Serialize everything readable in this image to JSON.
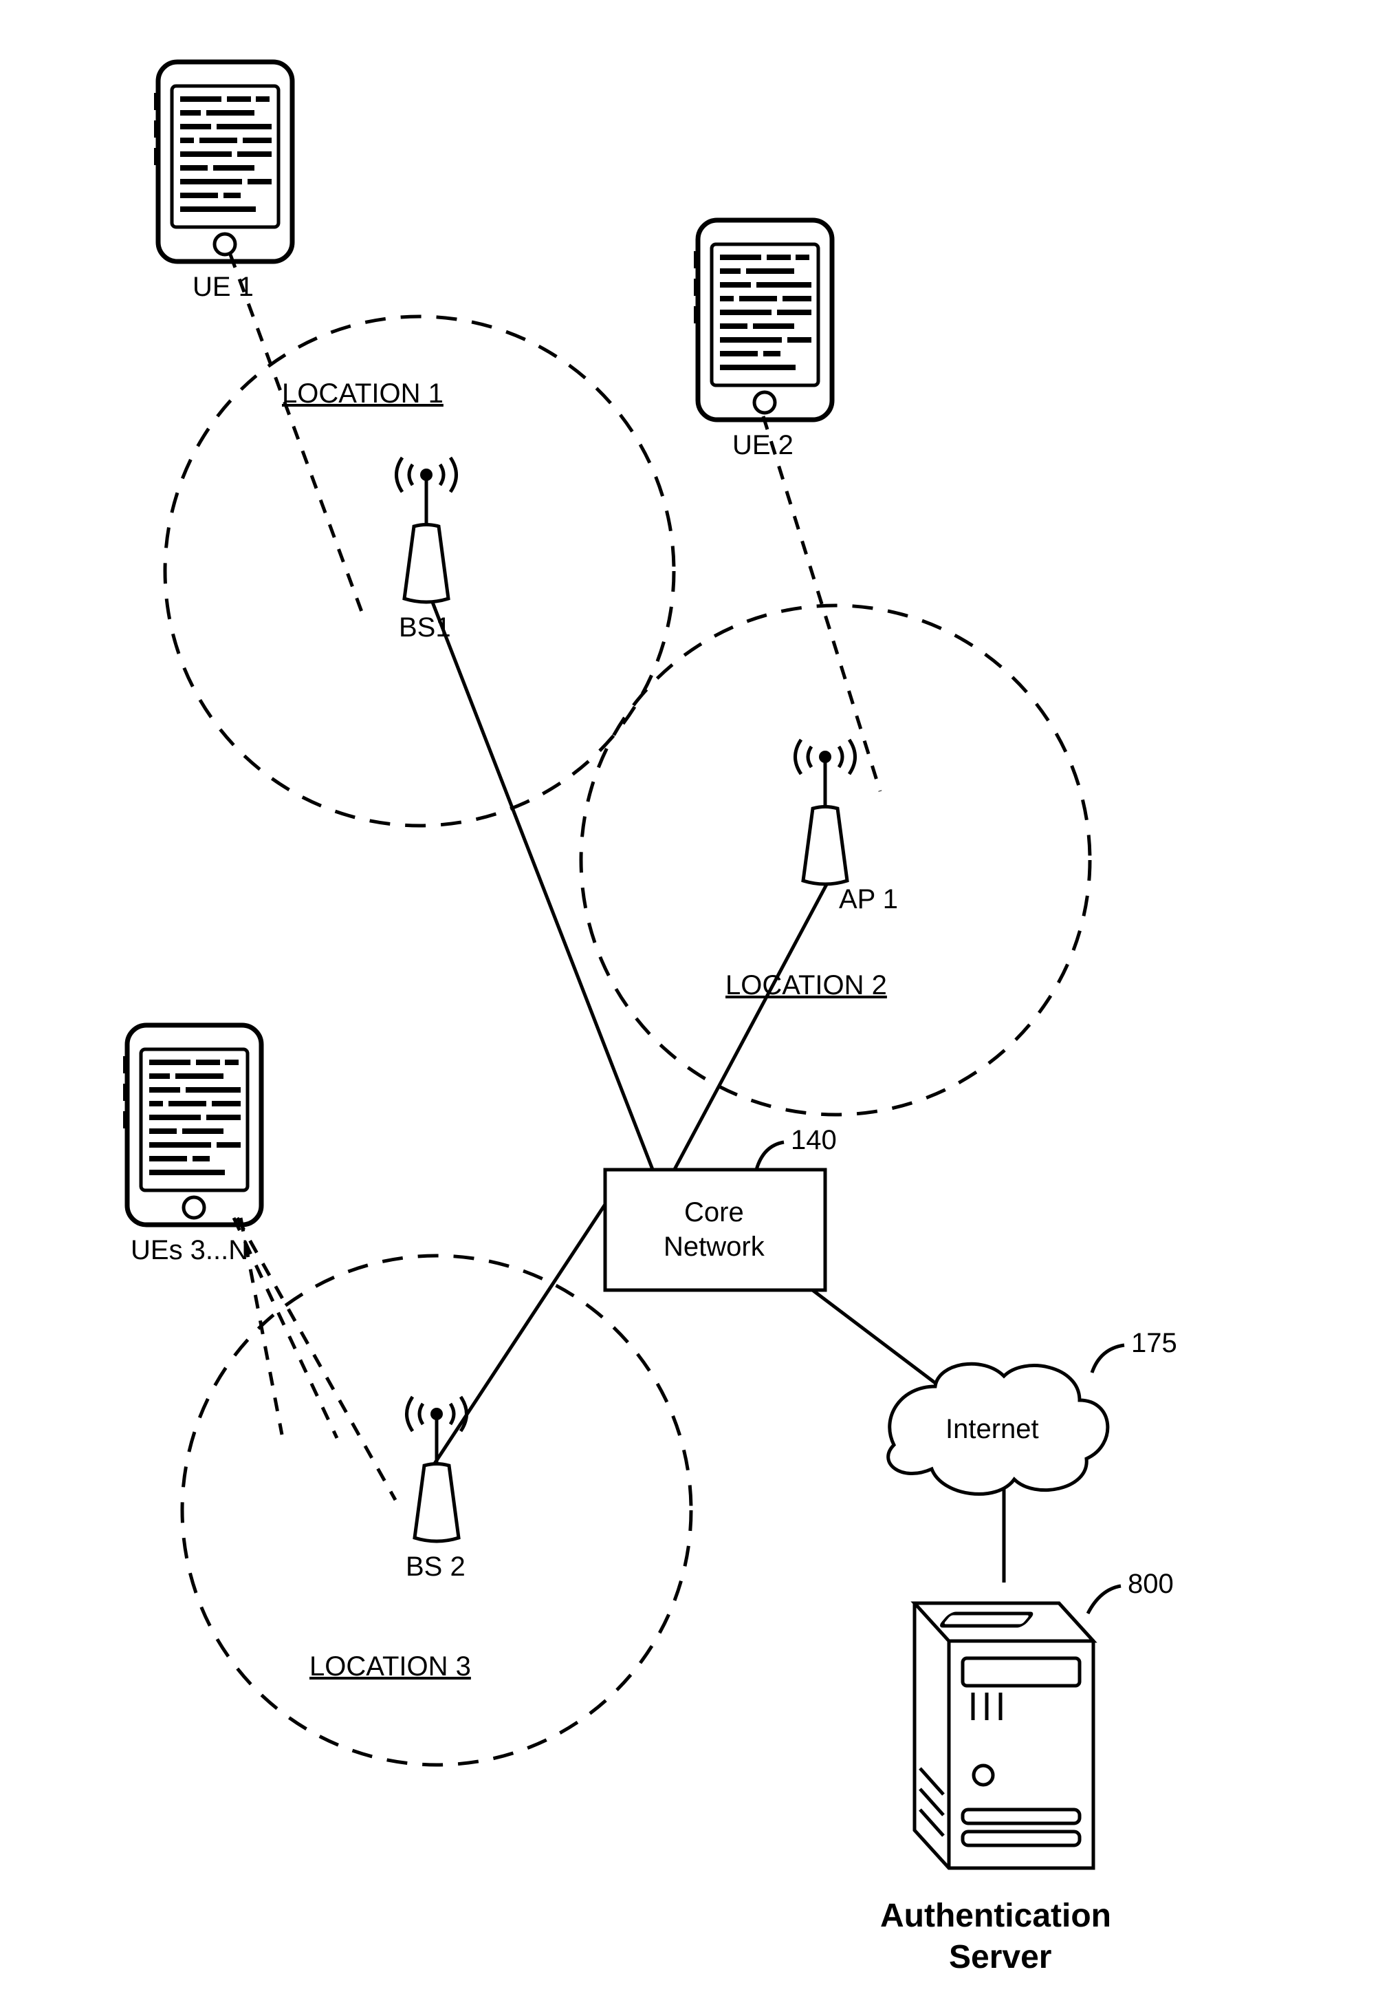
{
  "labels": {
    "ue1": "UE 1",
    "ue2": "UE 2",
    "ue3n": "UEs 3...N",
    "bs1": "BS1",
    "bs2": "BS 2",
    "ap1": "AP 1",
    "loc1": "LOCATION 1",
    "loc2": "LOCATION 2",
    "loc3": "LOCATION 3",
    "core": "Core",
    "network": "Network",
    "core_ref": "140",
    "internet": "Internet",
    "internet_ref": "175",
    "server_ref": "800",
    "auth1": "Authentication",
    "auth2": "Server"
  }
}
